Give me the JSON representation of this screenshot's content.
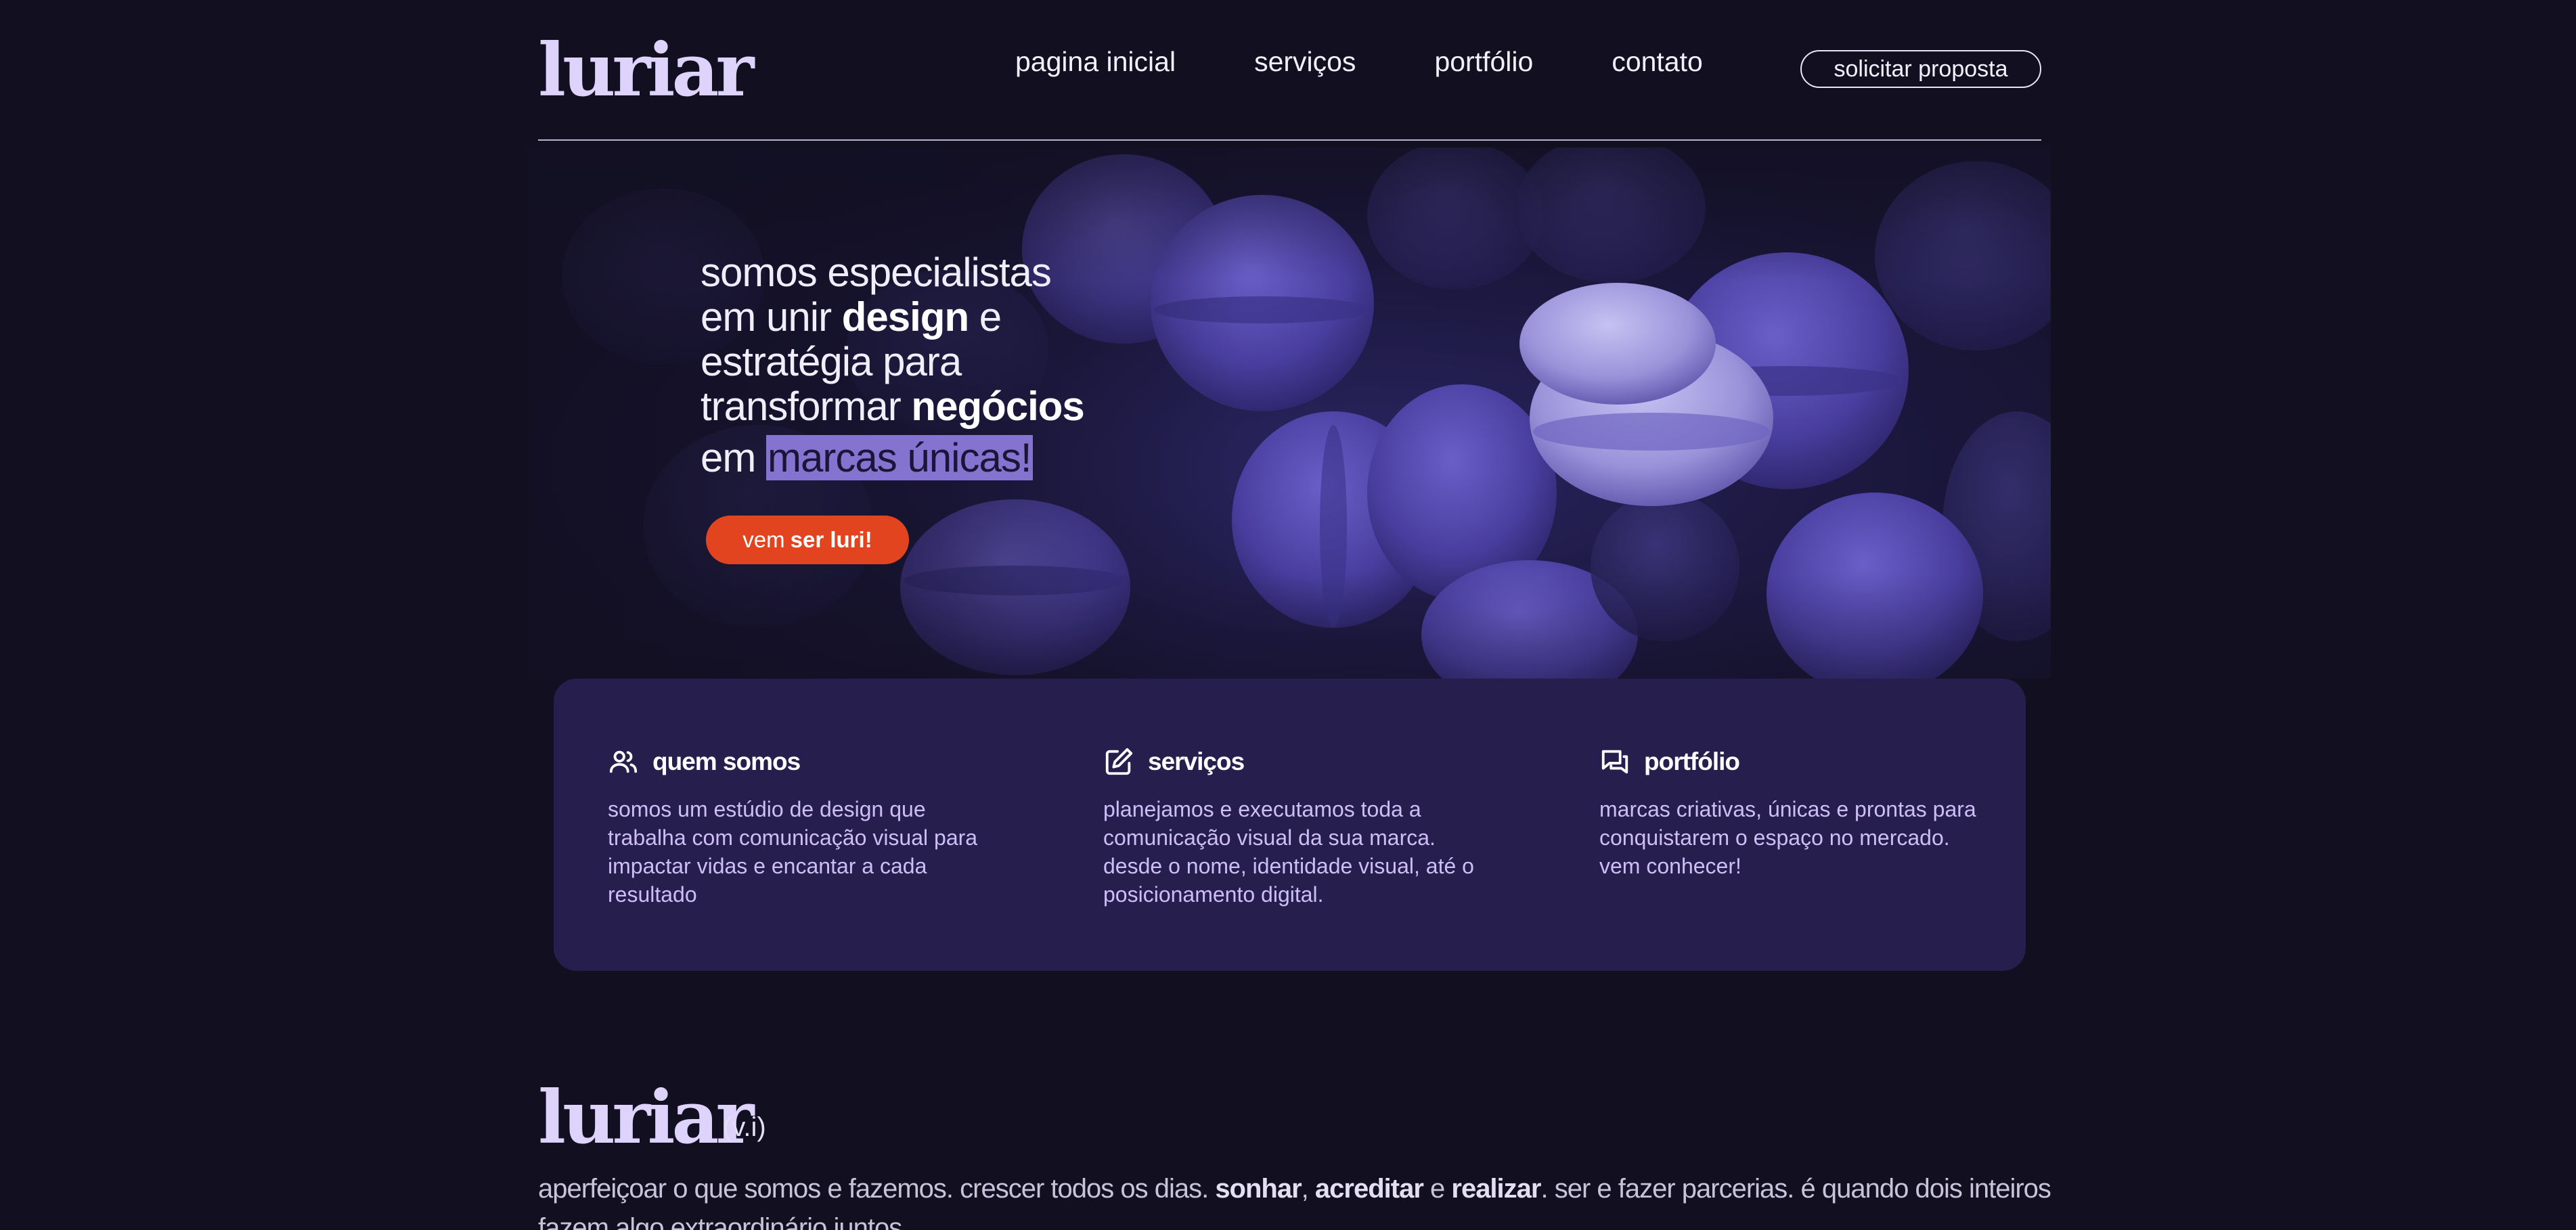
{
  "header": {
    "logo": "luriar",
    "nav": [
      "pagina inicial",
      "serviços",
      "portfólio",
      "contato"
    ],
    "cta": "solicitar proposta"
  },
  "hero": {
    "line1": "somos especialistas",
    "line2_pre": "em unir ",
    "line2_bold": "design",
    "line2_post": " e",
    "line3": "estratégia para",
    "line4_pre": "transformar ",
    "line4_bold": "negócios",
    "line5_pre": "em ",
    "line5_highlight": "marcas únicas!",
    "button_pre": "vem",
    "button_bold": "ser luri!"
  },
  "info": [
    {
      "icon": "users-icon",
      "title": "quem somos",
      "text": "somos um estúdio de design que trabalha com comunicação visual para impactar vidas e encantar a cada resultado"
    },
    {
      "icon": "edit-icon",
      "title": "serviços",
      "text": "planejamos e executamos toda a comunicação visual da sua marca. desde o nome, identidade visual, até o posicionamento digital."
    },
    {
      "icon": "chat-icon",
      "title": "portfólio",
      "text": "marcas criativas, únicas e prontas para conquistarem o espaço no mercado. vem conhecer!"
    }
  ],
  "about": {
    "logo": "luriar",
    "suffix": "(v.i)",
    "t1": "aperfeiçoar o que somos e fazemos. crescer todos os dias. ",
    "b1": "sonhar",
    "t2": ", ",
    "b2": "acreditar",
    "t3": " e ",
    "b3": "realizar",
    "t4": ". ser e fazer parcerias. é quando dois inteiros fazem algo extraordinário juntos."
  },
  "colors": {
    "background": "#120f21",
    "card": "#261e4d",
    "accent": "#e2441f",
    "highlight": "#8473cf"
  }
}
